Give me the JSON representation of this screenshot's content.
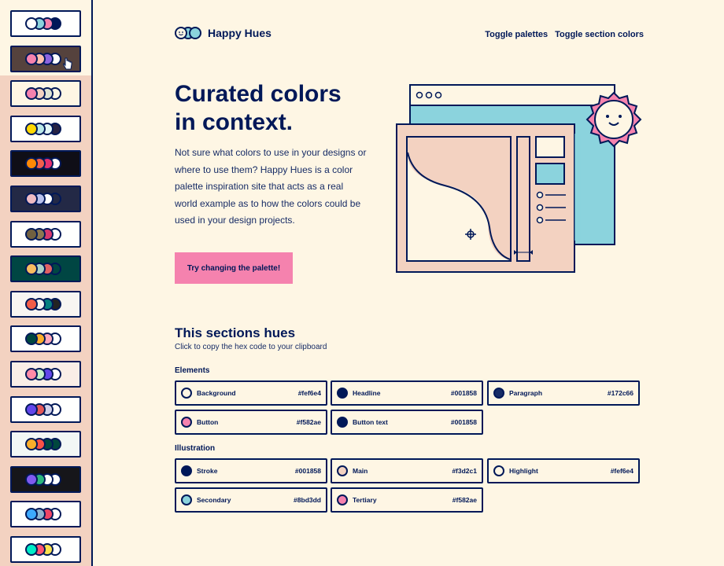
{
  "brand": {
    "name": "Happy Hues",
    "logo_colors": [
      "#fef6e4",
      "#8bd3dd",
      "#8bd3dd"
    ]
  },
  "nav": {
    "toggle_palettes": "Toggle palettes",
    "toggle_section_colors": "Toggle section colors"
  },
  "hero": {
    "title_line1": "Curated colors",
    "title_line2": "in context.",
    "paragraph": "Not sure what colors to use in your designs or where to use them? Happy Hues is a color palette inspiration site that acts as a real world example as to how the colors could be used in your design projects.",
    "cta_label": "Try changing the palette!"
  },
  "hues": {
    "title": "This sections hues",
    "subtitle": "Click to copy the hex code to your clipboard",
    "elements_label": "Elements",
    "illustration_label": "Illustration",
    "elements": [
      {
        "name": "Background",
        "hex": "#fef6e4"
      },
      {
        "name": "Headline",
        "hex": "#001858"
      },
      {
        "name": "Paragraph",
        "hex": "#172c66"
      },
      {
        "name": "Button",
        "hex": "#f582ae"
      },
      {
        "name": "Button text",
        "hex": "#001858"
      }
    ],
    "illustration": [
      {
        "name": "Stroke",
        "hex": "#001858"
      },
      {
        "name": "Main",
        "hex": "#f3d2c1"
      },
      {
        "name": "Highlight",
        "hex": "#fef6e4"
      },
      {
        "name": "Secondary",
        "hex": "#8bd3dd"
      },
      {
        "name": "Tertiary",
        "hex": "#f582ae"
      }
    ]
  },
  "palettes": [
    {
      "bg": "#fffffe",
      "dots": [
        "#fffffe",
        "#8bd3dd",
        "#f582ae",
        "#001858"
      ]
    },
    {
      "bg": "#55423d",
      "dots": [
        "#f582ae",
        "#ffc0ad",
        "#8c64e0",
        "#fffffe"
      ]
    },
    {
      "bg": "#fef6e4",
      "dots": [
        "#f582ae",
        "#f3d2c1",
        "#e0e4d4",
        "#fef6e4"
      ]
    },
    {
      "bg": "#fffffe",
      "dots": [
        "#ffd803",
        "#bae8e8",
        "#e3f6f5",
        "#272343"
      ]
    },
    {
      "bg": "#0f0e17",
      "dots": [
        "#ff8906",
        "#f25f4c",
        "#e53170",
        "#fffffe"
      ]
    },
    {
      "bg": "#232946",
      "dots": [
        "#eebbc3",
        "#b8c1ec",
        "#fffffe",
        "#232946"
      ]
    },
    {
      "bg": "#fffffe",
      "dots": [
        "#716040",
        "#8c7851",
        "#d9376e",
        "#fffffe"
      ]
    },
    {
      "bg": "#004643",
      "dots": [
        "#f9bc60",
        "#abd1c6",
        "#e16162",
        "#004643"
      ]
    },
    {
      "bg": "#f8f5f2",
      "dots": [
        "#f45d48",
        "#f8f5f2",
        "#078080",
        "#232323"
      ]
    },
    {
      "bg": "#fffffe",
      "dots": [
        "#00473e",
        "#faae2b",
        "#ffa8ba",
        "#fffffe"
      ]
    },
    {
      "bg": "#faeee7",
      "dots": [
        "#ff8ba7",
        "#c3f0ca",
        "#6246ea",
        "#fffffe"
      ]
    },
    {
      "bg": "#fffffe",
      "dots": [
        "#6246ea",
        "#e45858",
        "#d1d1e9",
        "#fffffe"
      ]
    },
    {
      "bg": "#f2f7f5",
      "dots": [
        "#faae2b",
        "#fa5246",
        "#00473e",
        "#00473e"
      ]
    },
    {
      "bg": "#16161a",
      "dots": [
        "#7f5af0",
        "#2cb67d",
        "#fffffe",
        "#fffffe"
      ]
    },
    {
      "bg": "#fffffe",
      "dots": [
        "#3da9fc",
        "#90b4ce",
        "#ef4565",
        "#fffffe"
      ]
    },
    {
      "bg": "#fffffe",
      "dots": [
        "#00ebc7",
        "#ff5470",
        "#fde24f",
        "#fffffe"
      ]
    }
  ]
}
